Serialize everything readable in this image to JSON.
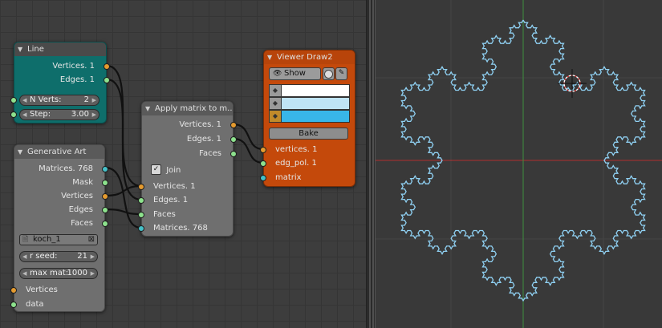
{
  "line_node": {
    "title": "Line",
    "out_vertices": "Vertices. 1",
    "out_edges": "Edges. 1",
    "n_verts_label": "N Verts:",
    "n_verts_value": "2",
    "step_label": "Step:",
    "step_value": "3.00"
  },
  "gen_node": {
    "title": "Generative Art",
    "out_matrices": "Matrices. 768",
    "out_mask": "Mask",
    "out_vertices": "Vertices",
    "out_edges": "Edges",
    "out_faces": "Faces",
    "file_name": "koch_1",
    "rseed_label": "r seed:",
    "rseed_value": "21",
    "maxmat_label": "max mat:",
    "maxmat_value": "1000",
    "in_vertices": "Vertices",
    "in_data": "data"
  },
  "apply_node": {
    "title": "Apply matrix to m...",
    "out_vertices": "Vertices. 1",
    "out_edges": "Edges. 1",
    "out_faces": "Faces",
    "join_label": "Join",
    "in_vertices": "Vertices. 1",
    "in_edges": "Edges. 1",
    "in_faces": "Faces",
    "in_matrices": "Matrices. 768"
  },
  "viewer_node": {
    "title": "Viewer Draw2",
    "show_label": "Show",
    "bake_label": "Bake",
    "in_vertices": "vertices. 1",
    "in_edges": "edg_pol. 1",
    "in_matrix": "matrix",
    "colors": [
      "#ffffff",
      "#bfe4f5",
      "#38b6e8"
    ]
  },
  "theme": {
    "node_teal": "#0e6e6b",
    "node_grey": "#6f6f6f",
    "node_orange": "#c4490b",
    "socket_vertices": "#e59b2f",
    "socket_edges": "#8de28d",
    "socket_matrix": "#45c0c8",
    "snowflake": "#8fd0f2",
    "axis_x": "#b03030",
    "axis_y": "#3e8f3e"
  }
}
